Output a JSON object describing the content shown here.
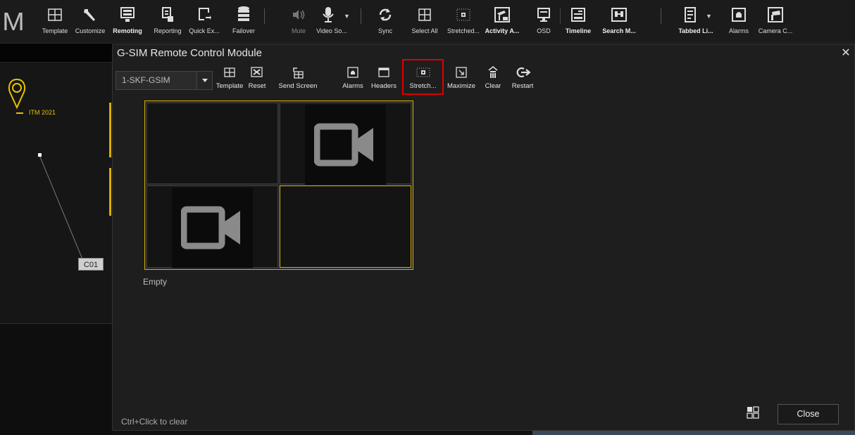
{
  "ribbon": {
    "logo": "M",
    "buttons": [
      {
        "label": "Template",
        "icon": "grid-icon"
      },
      {
        "label": "Customize",
        "icon": "wrench-icon"
      },
      {
        "label": "Remoting",
        "icon": "remote-monitor-icon"
      },
      {
        "label": "Reporting",
        "icon": "report-icon"
      },
      {
        "label": "Quick Ex...",
        "icon": "export-icon"
      },
      {
        "label": "Failover",
        "icon": "database-icon"
      },
      {
        "label": "Mute",
        "icon": "speaker-icon"
      },
      {
        "label": "Video So...",
        "icon": "microphone-icon"
      },
      {
        "label": "Sync",
        "icon": "sync-icon"
      },
      {
        "label": "Select All",
        "icon": "grid-icon"
      },
      {
        "label": "Stretched...",
        "icon": "stretch-icon"
      },
      {
        "label": "Activity A...",
        "icon": "activity-icon"
      },
      {
        "label": "OSD",
        "icon": "osd-icon"
      },
      {
        "label": "Timeline",
        "icon": "timeline-icon"
      },
      {
        "label": "Search M...",
        "icon": "binoculars-icon"
      },
      {
        "label": "Tabbed Li...",
        "icon": "tabbed-icon"
      },
      {
        "label": "Alarms",
        "icon": "alarm-icon"
      },
      {
        "label": "Camera C...",
        "icon": "camera-icon"
      }
    ]
  },
  "map": {
    "site_label": "ITM 2021",
    "camera_label": "C01"
  },
  "dialog": {
    "title": "G-SIM Remote Control Module",
    "close_glyph": "✕",
    "device_select": "1-SKF-GSIM",
    "toolbar": [
      {
        "label": "Template",
        "icon": "grid-icon"
      },
      {
        "label": "Reset",
        "icon": "reset-icon"
      },
      {
        "label": "Send Screen",
        "icon": "send-screen-icon"
      },
      {
        "label": "Alarms",
        "icon": "alarm-icon"
      },
      {
        "label": "Headers",
        "icon": "headers-icon"
      },
      {
        "label": "Stretch...",
        "icon": "stretch-icon"
      },
      {
        "label": "Maximize",
        "icon": "maximize-icon"
      },
      {
        "label": "Clear",
        "icon": "clear-icon"
      },
      {
        "label": "Restart",
        "icon": "restart-icon"
      }
    ],
    "grid_status": "Empty",
    "hint": "Ctrl+Click to clear",
    "close_button": "Close"
  },
  "colors": {
    "accent": "#d6ad00",
    "highlight": "#e00000",
    "background": "#1e1e1e"
  }
}
